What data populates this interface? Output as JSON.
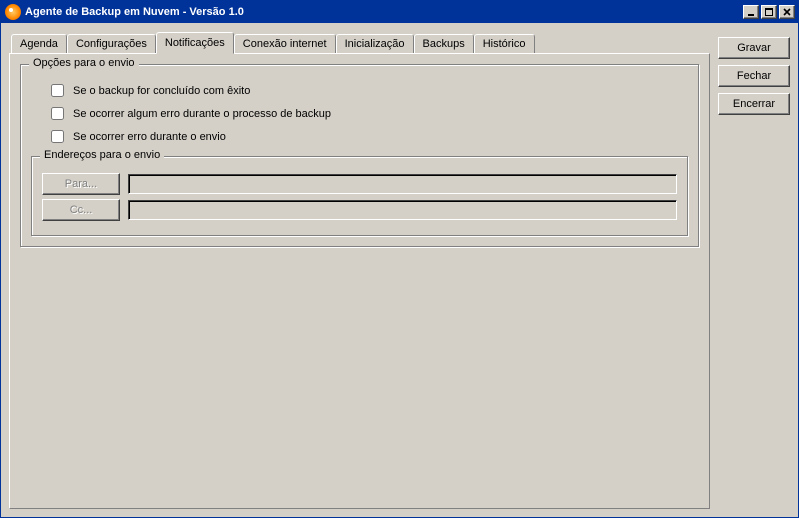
{
  "window": {
    "title": "Agente de Backup em Nuvem - Versão 1.0"
  },
  "tabs": [
    {
      "label": "Agenda"
    },
    {
      "label": "Configurações"
    },
    {
      "label": "Notificações"
    },
    {
      "label": "Conexão internet"
    },
    {
      "label": "Inicialização"
    },
    {
      "label": "Backups"
    },
    {
      "label": "Histórico"
    }
  ],
  "active_tab_index": 2,
  "groups": {
    "send_options": {
      "legend": "Opções para o envio",
      "checkboxes": [
        {
          "label": "Se o backup for concluído com êxito",
          "checked": false
        },
        {
          "label": "Se ocorrer algum erro durante o processo de backup",
          "checked": false
        },
        {
          "label": "Se ocorrer erro durante o envio",
          "checked": false
        }
      ]
    },
    "addresses": {
      "legend": "Endereços para o envio",
      "para_button": "Para...",
      "cc_button": "Cc...",
      "para_value": "",
      "cc_value": ""
    }
  },
  "buttons": {
    "save": "Gravar",
    "close": "Fechar",
    "shutdown": "Encerrar"
  }
}
